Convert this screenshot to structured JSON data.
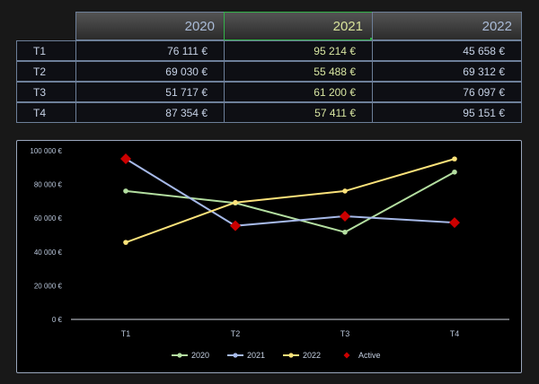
{
  "table": {
    "years": [
      "2020",
      "2021",
      "2022"
    ],
    "selected_year": "2021",
    "rows": [
      {
        "label": "T1",
        "values": [
          "76 111 €",
          "95 214 €",
          "45 658 €"
        ]
      },
      {
        "label": "T2",
        "values": [
          "69 030 €",
          "55 488 €",
          "69 312 €"
        ]
      },
      {
        "label": "T3",
        "values": [
          "51 717 €",
          "61 200 €",
          "76 097 €"
        ]
      },
      {
        "label": "T4",
        "values": [
          "87 354 €",
          "57 411 €",
          "95 151 €"
        ]
      }
    ]
  },
  "chart_data": {
    "type": "line",
    "categories": [
      "T1",
      "T2",
      "T3",
      "T4"
    ],
    "ylim": [
      0,
      100000
    ],
    "yticks": [
      "0 €",
      "20 000 €",
      "40 000 €",
      "60 000 €",
      "80 000 €",
      "100 000 €"
    ],
    "grid": false,
    "legend_position": "bottom",
    "series": [
      {
        "name": "2020",
        "values": [
          76111,
          69030,
          51717,
          87354
        ],
        "color": "#b3dea0",
        "marker": "circle"
      },
      {
        "name": "2021",
        "values": [
          95214,
          55488,
          61200,
          57411
        ],
        "color": "#a6b9e8",
        "marker": "circle"
      },
      {
        "name": "2022",
        "values": [
          45658,
          69312,
          76097,
          95151
        ],
        "color": "#fbe27a",
        "marker": "circle"
      },
      {
        "name": "Active",
        "values": [
          95214,
          55488,
          61200,
          57411
        ],
        "color": "#cc0000",
        "marker": "diamond"
      }
    ]
  }
}
